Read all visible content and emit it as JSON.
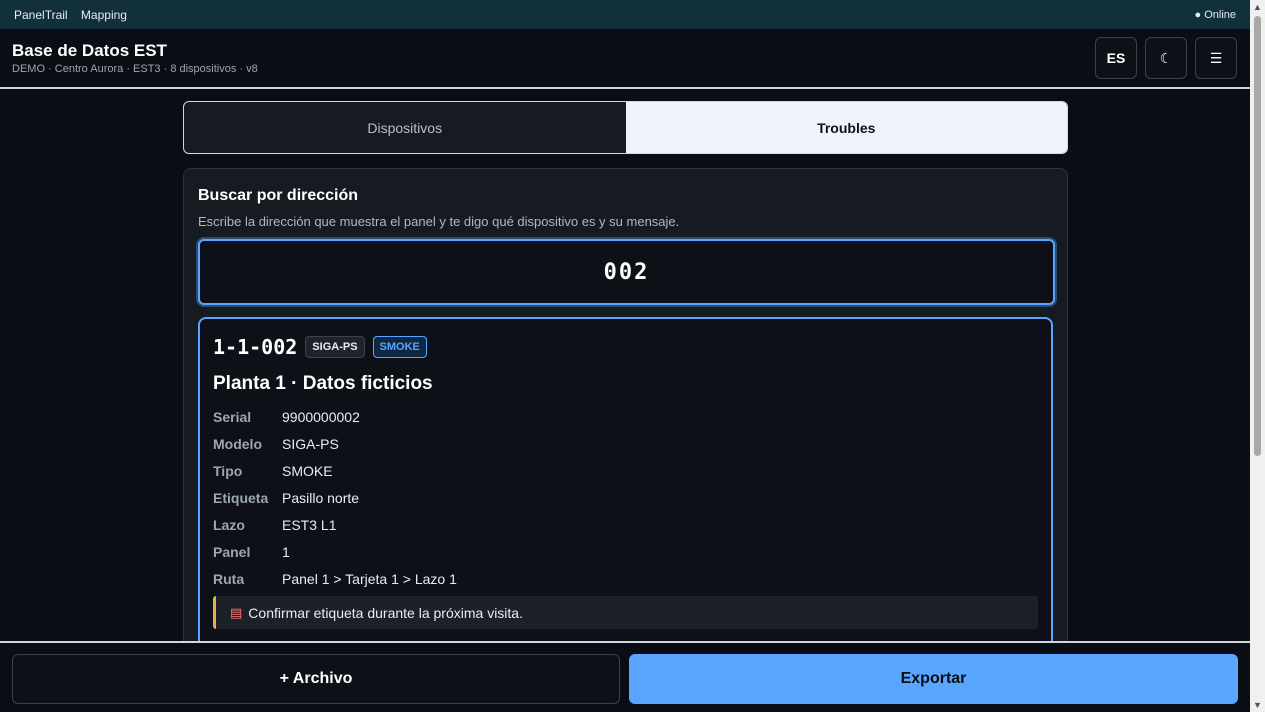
{
  "sysbar": {
    "app": "PanelTrail",
    "menu": "Mapping",
    "status": "● Online"
  },
  "header": {
    "title": "Base de Datos EST",
    "subtitle": "DEMO · Centro Aurora · EST3 · 8 dispositivos · v8",
    "lang_label": "ES",
    "theme_icon": "☾",
    "menu_icon": "☰"
  },
  "tabs": [
    {
      "label": "Dispositivos",
      "active": false
    },
    {
      "label": "Troubles",
      "active": true
    }
  ],
  "search": {
    "title": "Buscar por dirección",
    "hint": "Escribe la dirección que muestra el panel y te digo qué dispositivo es y su mensaje.",
    "value": "002"
  },
  "result": {
    "address": "1-1-002",
    "model_badge": "SIGA-PS",
    "type_badge": "SMOKE",
    "location": "Planta 1 · Datos ficticios",
    "fields": [
      {
        "key": "Serial",
        "value": "9900000002"
      },
      {
        "key": "Modelo",
        "value": "SIGA-PS"
      },
      {
        "key": "Tipo",
        "value": "SMOKE"
      },
      {
        "key": "Etiqueta",
        "value": "Pasillo norte"
      },
      {
        "key": "Lazo",
        "value": "EST3 L1"
      },
      {
        "key": "Panel",
        "value": "1"
      },
      {
        "key": "Ruta",
        "value": "Panel 1 > Tarjeta 1 > Lazo 1"
      }
    ],
    "note": "Confirmar etiqueta durante la próxima visita.",
    "note_icon": "note-icon"
  },
  "footer": {
    "file_label": "+ Archivo",
    "export_label": "Exportar"
  },
  "colors": {
    "accent": "#58a6ff",
    "note_border": "#e3b341",
    "background": "#0a0e14"
  }
}
